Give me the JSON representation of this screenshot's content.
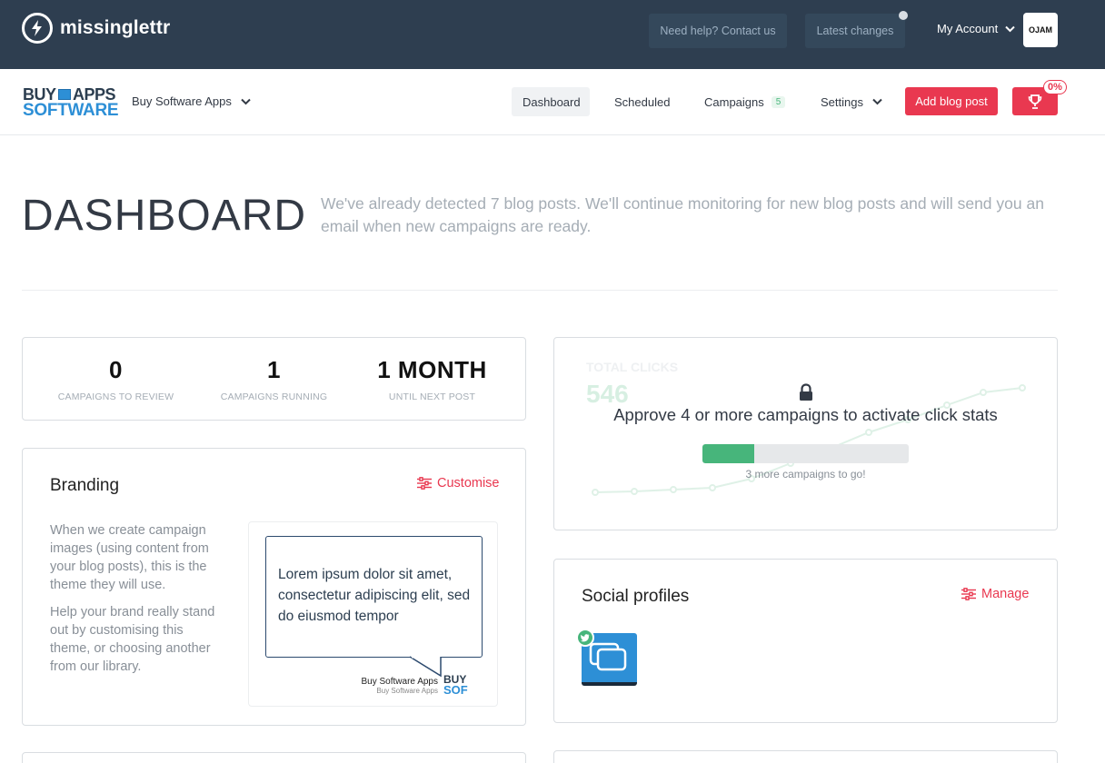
{
  "app": {
    "name": "missinglettr"
  },
  "topbar": {
    "help_label": "Need help? Contact us",
    "latest_label": "Latest changes",
    "account_label": "My Account",
    "avatar_text": "OJAM"
  },
  "nav": {
    "org_logo_line1": "BUY",
    "org_logo_line1b": "APPS",
    "org_logo_line2": "SOFTWARE",
    "org_name": "Buy Software Apps",
    "items": [
      {
        "label": "Dashboard",
        "active": true
      },
      {
        "label": "Scheduled"
      },
      {
        "label": "Campaigns",
        "count": "5"
      },
      {
        "label": "Settings"
      }
    ],
    "add_post_label": "Add blog post",
    "trophy_progress": "0%"
  },
  "page": {
    "title": "DASHBOARD",
    "intro": "We've already detected 7 blog posts. We'll continue monitoring for new blog posts and will send you an email when new campaigns are ready."
  },
  "stats": [
    {
      "value": "0",
      "label": "CAMPAIGNS TO REVIEW"
    },
    {
      "value": "1",
      "label": "CAMPAIGNS RUNNING"
    },
    {
      "value": "1 MONTH",
      "label": "UNTIL NEXT POST"
    }
  ],
  "clicks": {
    "ghost_label": "TOTAL CLICKS",
    "ghost_value": "546",
    "message": "Approve 4 or more campaigns to activate click stats",
    "progress_fraction": 0.25,
    "progress_note": "3 more campaigns to go!"
  },
  "branding": {
    "title": "Branding",
    "action_label": "Customise",
    "desc_p1": "When we create campaign images (using content from your blog posts), this is the theme they will use.",
    "desc_p2": "Help your brand really stand out by customising this theme, or choosing another from our library.",
    "preview_text": "Lorem ipsum dolor sit amet, consectetur adipiscing elit, sed do eiusmod tempor",
    "preview_brand_name": "Buy Software Apps",
    "preview_brand_sub": "Buy Software Apps",
    "preview_logo_a": "BUY",
    "preview_logo_b": "SOF"
  },
  "social": {
    "title": "Social profiles",
    "action_label": "Manage",
    "profiles": [
      {
        "network": "twitter",
        "icon": "twitter-icon"
      }
    ]
  },
  "colors": {
    "topbar": "#2e3e50",
    "accent": "#e93850",
    "success": "#47b57b",
    "brand_blue": "#2d8fd6"
  }
}
